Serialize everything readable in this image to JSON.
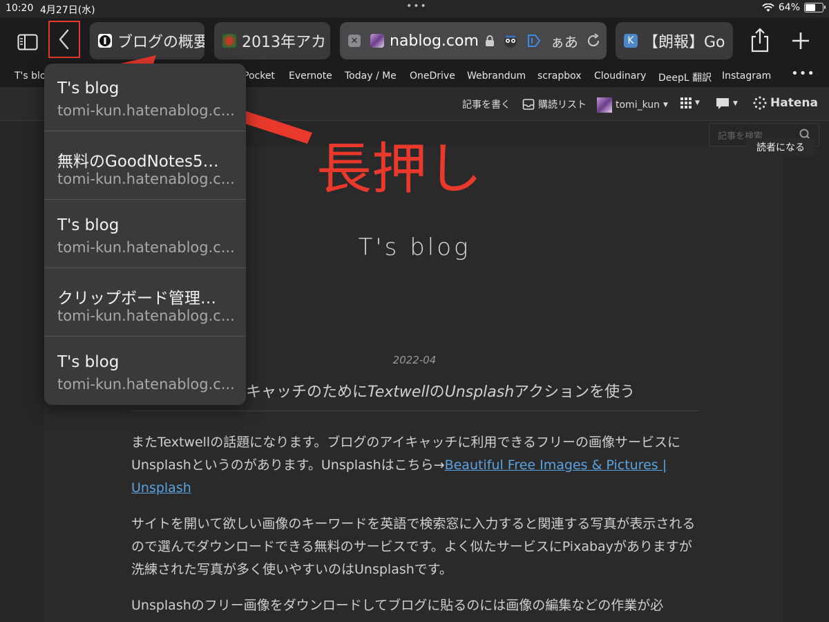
{
  "status": {
    "time": "10:20",
    "date": "4月27日(水)",
    "dots": "•••",
    "battery": "64%",
    "battery_level": 0.64
  },
  "toolbar": {
    "tabs": [
      {
        "title": "ブログの概要"
      },
      {
        "title": "2013年アカ"
      },
      {
        "url": "nablog.com",
        "aa": "ぁあ"
      },
      {
        "title": "【朗報】Go"
      }
    ]
  },
  "bookmarks": [
    "T's blo",
    "Pocket",
    "Evernote",
    "Today / Me",
    "OneDrive",
    "Webrandum",
    "scrapbox",
    "Cloudinary",
    "DeepL 翻訳",
    "Instagram"
  ],
  "hatena": {
    "write": "記事を書く",
    "reading_list": "購読リスト",
    "user": "tomi_kun",
    "logo": "Hatena",
    "search_placeholder": "記事を検索",
    "reader_button": "読者になる"
  },
  "history_popup": [
    {
      "title": "T's blog",
      "url": "tomi-kun.hatenablog.c..."
    },
    {
      "title": "無料のGoodNotes5…",
      "url": "tomi-kun.hatenablog.c..."
    },
    {
      "title": "T's blog",
      "url": "tomi-kun.hatenablog.c..."
    },
    {
      "title": "クリップボード管理…",
      "url": "tomi-kun.hatenablog.c..."
    },
    {
      "title": "T's blog",
      "url": "tomi-kun.hatenablog.c..."
    }
  ],
  "callout": {
    "text": "長押し",
    "color": "#e8392c"
  },
  "blog": {
    "title": "T's blog",
    "date": "2022-04",
    "post_title_1": "キャッチのために",
    "post_title_2": "Textwell",
    "post_title_3": "の",
    "post_title_4": "Unsplash",
    "post_title_5": "アクションを使う",
    "p1_text": "またTextwellの話題になります。ブログのアイキャッチに利用できるフリーの画像サービスにUnsplashというのがあります。Unsplashはこちら→",
    "p1_link": "Beautiful Free Images & Pictures | Unsplash",
    "p2": "サイトを開いて欲しい画像のキーワードを英語で検索窓に入力すると関連する写真が表示されるので選んでダウンロードできる無料のサービスです。よく似たサービスにPixabayがありますが洗練された写真が多く使いやすいのはUnsplashです。",
    "p3": "Unsplashのフリー画像をダウンロードしてブログに貼るのには画像の編集などの作業が必"
  }
}
